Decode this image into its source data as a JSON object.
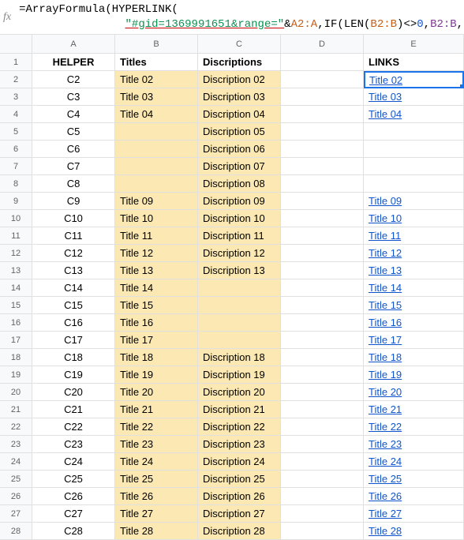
{
  "formula": {
    "line1": "=ArrayFormula(HYPERLINK(",
    "string_part": "\"#gid=1369991651&range=\"",
    "amp1": "&",
    "ref_a": "A2:A",
    "comma1": ",",
    "if_open": "IF(",
    "len_open": "LEN(",
    "ref_b1": "B2:B",
    "len_close": ")",
    "cmp": "<>",
    "zero": "0",
    "comma2": ",",
    "ref_b2": "B2:B",
    "comma3": ",",
    "empty": "\"\"",
    "close": ")))"
  },
  "columns": [
    "A",
    "B",
    "C",
    "D",
    "E"
  ],
  "headers": {
    "A": "HELPER",
    "B": "Titles",
    "C": "Discriptions",
    "D": "",
    "E": "LINKS"
  },
  "rows": [
    {
      "n": 2,
      "h": "C2",
      "t": "Title 02",
      "d": "Discription 02",
      "l": "Title 02"
    },
    {
      "n": 3,
      "h": "C3",
      "t": "Title 03",
      "d": "Discription 03",
      "l": "Title 03"
    },
    {
      "n": 4,
      "h": "C4",
      "t": "Title 04",
      "d": "Discription 04",
      "l": "Title 04"
    },
    {
      "n": 5,
      "h": "C5",
      "t": "",
      "d": "Discription 05",
      "l": ""
    },
    {
      "n": 6,
      "h": "C6",
      "t": "",
      "d": "Discription 06",
      "l": ""
    },
    {
      "n": 7,
      "h": "C7",
      "t": "",
      "d": "Discription 07",
      "l": ""
    },
    {
      "n": 8,
      "h": "C8",
      "t": "",
      "d": "Discription 08",
      "l": ""
    },
    {
      "n": 9,
      "h": "C9",
      "t": "Title 09",
      "d": "Discription 09",
      "l": "Title 09"
    },
    {
      "n": 10,
      "h": "C10",
      "t": "Title 10",
      "d": "Discription 10",
      "l": "Title 10"
    },
    {
      "n": 11,
      "h": "C11",
      "t": "Title 11",
      "d": "Discription 11",
      "l": "Title 11"
    },
    {
      "n": 12,
      "h": "C12",
      "t": "Title 12",
      "d": "Discription 12",
      "l": "Title 12"
    },
    {
      "n": 13,
      "h": "C13",
      "t": "Title 13",
      "d": "Discription 13",
      "l": "Title 13"
    },
    {
      "n": 14,
      "h": "C14",
      "t": "Title 14",
      "d": "",
      "l": "Title 14"
    },
    {
      "n": 15,
      "h": "C15",
      "t": "Title 15",
      "d": "",
      "l": "Title 15"
    },
    {
      "n": 16,
      "h": "C16",
      "t": "Title 16",
      "d": "",
      "l": "Title 16"
    },
    {
      "n": 17,
      "h": "C17",
      "t": "Title 17",
      "d": "",
      "l": "Title 17"
    },
    {
      "n": 18,
      "h": "C18",
      "t": "Title 18",
      "d": "Discription 18",
      "l": "Title 18"
    },
    {
      "n": 19,
      "h": "C19",
      "t": "Title 19",
      "d": "Discription 19",
      "l": "Title 19"
    },
    {
      "n": 20,
      "h": "C20",
      "t": "Title 20",
      "d": "Discription 20",
      "l": "Title 20"
    },
    {
      "n": 21,
      "h": "C21",
      "t": "Title 21",
      "d": "Discription 21",
      "l": "Title 21"
    },
    {
      "n": 22,
      "h": "C22",
      "t": "Title 22",
      "d": "Discription 22",
      "l": "Title 22"
    },
    {
      "n": 23,
      "h": "C23",
      "t": "Title 23",
      "d": "Discription 23",
      "l": "Title 23"
    },
    {
      "n": 24,
      "h": "C24",
      "t": "Title 24",
      "d": "Discription 24",
      "l": "Title 24"
    },
    {
      "n": 25,
      "h": "C25",
      "t": "Title 25",
      "d": "Discription 25",
      "l": "Title 25"
    },
    {
      "n": 26,
      "h": "C26",
      "t": "Title 26",
      "d": "Discription 26",
      "l": "Title 26"
    },
    {
      "n": 27,
      "h": "C27",
      "t": "Title 27",
      "d": "Discription 27",
      "l": "Title 27"
    },
    {
      "n": 28,
      "h": "C28",
      "t": "Title 28",
      "d": "Discription 28",
      "l": "Title 28"
    }
  ]
}
